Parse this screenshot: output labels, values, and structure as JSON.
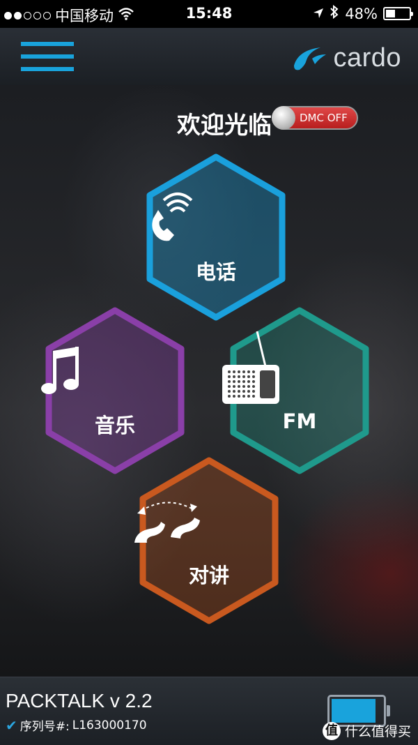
{
  "status_bar": {
    "carrier": "中国移动",
    "time": "15:48",
    "battery_percent": "48%",
    "battery_level": 0.48,
    "signal_dots_filled": 2,
    "signal_dots_total": 5
  },
  "header": {
    "logo_text": "cardo",
    "accent_color": "#19a3dc"
  },
  "main": {
    "welcome_text": "欢迎光临",
    "dmc_toggle_label": "DMC OFF",
    "buttons": {
      "phone": {
        "label": "电话",
        "color": "#1aa0dc",
        "icon": "phone-icon"
      },
      "music": {
        "label": "音乐",
        "color": "#8a3fa8",
        "icon": "music-note-icon"
      },
      "fm": {
        "label": "FM",
        "color": "#1f9a8c",
        "icon": "radio-icon"
      },
      "intercom": {
        "label": "对讲",
        "color": "#c9591f",
        "icon": "intercom-icon"
      }
    }
  },
  "footer": {
    "model": "PACKTALK v 2.2",
    "serial_label": "序列号#:",
    "serial_value": "L163000170",
    "device_battery_level": 0.88,
    "watermark_text": "什么值得买",
    "watermark_badge": "值"
  }
}
